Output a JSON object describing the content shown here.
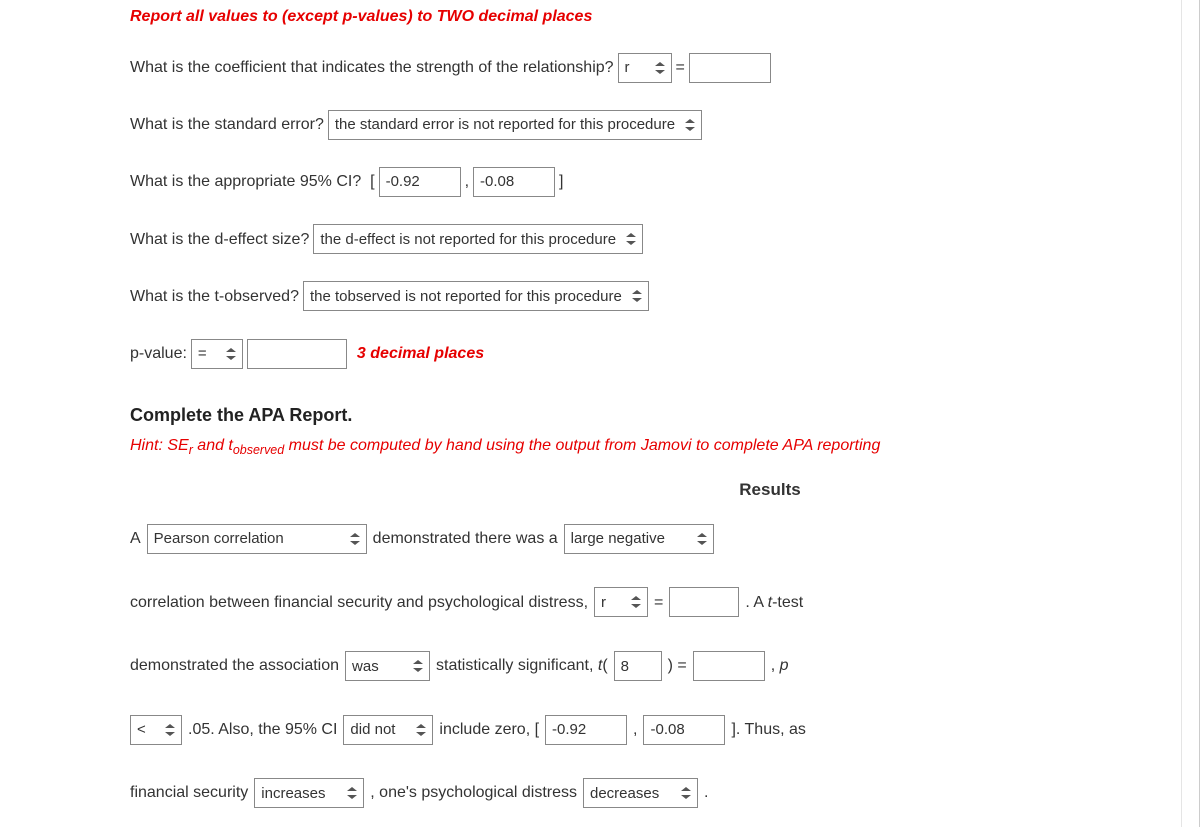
{
  "instruction_head": "Report all values to (except p-values) to TWO decimal places",
  "q1": {
    "text": "What is the coefficient that indicates the strength of the relationship?",
    "symbol": "r",
    "eq": "="
  },
  "q2": {
    "text": "What is the standard error?",
    "selected": "the standard error is not reported for this procedure"
  },
  "q3": {
    "text": "What is the appropriate 95% CI?  [",
    "lo": "-0.92",
    "comma": ",",
    "hi": "-0.08",
    "close": "]"
  },
  "q4": {
    "text": "What is the d-effect size?",
    "selected": "the d-effect is not reported for this procedure"
  },
  "q5": {
    "text": "What is the t-observed?",
    "selected": "the tobserved is not reported for this procedure"
  },
  "q6": {
    "label": "p-value:",
    "op": "=",
    "note": "3 decimal places"
  },
  "apa": {
    "heading": "Complete the APA Report.",
    "hint_pre": "Hint: SE",
    "hint_sub1": "r",
    "hint_mid": " and t",
    "hint_sub2": "observed",
    "hint_post": " must be computed by hand using the output from Jamovi to complete APA reporting",
    "results_title": "Results",
    "A": "A",
    "s1": "Pearson correlation",
    "t1": "demonstrated there was a",
    "s2": "large negative",
    "t2": "correlation between financial security and psychological distress,",
    "sym_r": "r",
    "eq": "=",
    "t3a": ". A ",
    "t3b": "t",
    "t3c": "-test",
    "t4": "demonstrated the association",
    "s3": "was",
    "t5a": "statistically significant, ",
    "t5b": "t",
    "t5c": "(",
    "df": "8",
    "t5d": ") =",
    "t6a": ", ",
    "t6b": "p",
    "s4": "<",
    "t7": ".05. Also, the 95% CI",
    "s5": "did not",
    "t8": "include zero, [",
    "lo": "-0.92",
    "comma": ",",
    "hi": "-0.08",
    "t9": "]. Thus, as",
    "t10": "financial security",
    "s6": "increases",
    "t11": ", one's psychological distress",
    "s7": "decreases",
    "t12": "."
  }
}
